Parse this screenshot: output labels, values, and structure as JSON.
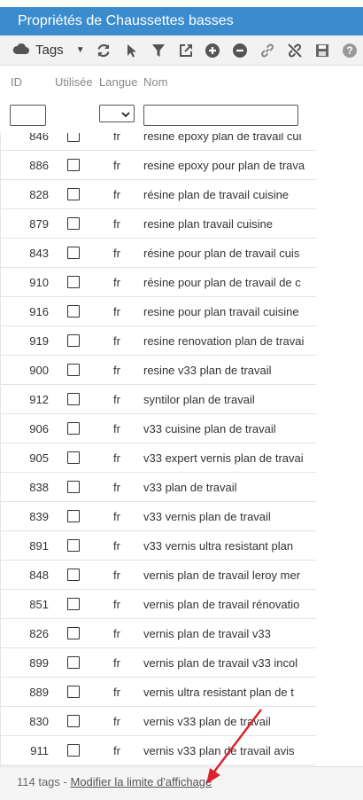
{
  "window": {
    "title": "Propriétés de Chaussettes basses"
  },
  "toolbar": {
    "tags_label": "Tags",
    "icons": [
      "cloud-icon",
      "refresh-icon",
      "pointer-icon",
      "filter-icon",
      "export-icon",
      "add-icon",
      "remove-icon",
      "link-icon",
      "unlink-icon",
      "save-icon",
      "help-icon"
    ]
  },
  "columns": {
    "id": "ID",
    "used": "Utilisée",
    "lang": "Langue",
    "name": "Nom"
  },
  "filters": {
    "id": "",
    "lang": "",
    "name": ""
  },
  "rows": [
    {
      "id": "846",
      "used": false,
      "lang": "fr",
      "name": "resine epoxy plan de travail cui"
    },
    {
      "id": "886",
      "used": false,
      "lang": "fr",
      "name": "resine epoxy pour plan de trava"
    },
    {
      "id": "828",
      "used": false,
      "lang": "fr",
      "name": "résine plan de travail cuisine"
    },
    {
      "id": "879",
      "used": false,
      "lang": "fr",
      "name": "resine plan travail cuisine"
    },
    {
      "id": "843",
      "used": false,
      "lang": "fr",
      "name": "résine pour plan de travail cuis"
    },
    {
      "id": "910",
      "used": false,
      "lang": "fr",
      "name": "résine pour plan de travail de c"
    },
    {
      "id": "916",
      "used": false,
      "lang": "fr",
      "name": "resine pour plan travail cuisine"
    },
    {
      "id": "919",
      "used": false,
      "lang": "fr",
      "name": "resine renovation plan de travai"
    },
    {
      "id": "900",
      "used": false,
      "lang": "fr",
      "name": "resine v33 plan de travail"
    },
    {
      "id": "912",
      "used": false,
      "lang": "fr",
      "name": "syntilor plan de travail"
    },
    {
      "id": "906",
      "used": false,
      "lang": "fr",
      "name": "v33 cuisine plan de travail"
    },
    {
      "id": "905",
      "used": false,
      "lang": "fr",
      "name": "v33 expert vernis plan de travai"
    },
    {
      "id": "838",
      "used": false,
      "lang": "fr",
      "name": "v33 plan de travail"
    },
    {
      "id": "839",
      "used": false,
      "lang": "fr",
      "name": "v33 vernis plan de travail"
    },
    {
      "id": "891",
      "used": false,
      "lang": "fr",
      "name": "v33 vernis ultra resistant plan"
    },
    {
      "id": "848",
      "used": false,
      "lang": "fr",
      "name": "vernis plan de travail leroy mer"
    },
    {
      "id": "851",
      "used": false,
      "lang": "fr",
      "name": "vernis plan de travail rénovatio"
    },
    {
      "id": "826",
      "used": false,
      "lang": "fr",
      "name": "vernis plan de travail v33"
    },
    {
      "id": "899",
      "used": false,
      "lang": "fr",
      "name": "vernis plan de travail v33 incol"
    },
    {
      "id": "889",
      "used": false,
      "lang": "fr",
      "name": "vernis ultra resistant plan de t"
    },
    {
      "id": "830",
      "used": false,
      "lang": "fr",
      "name": "vernis v33 plan de travail"
    },
    {
      "id": "911",
      "used": false,
      "lang": "fr",
      "name": "vernis v33 plan de travail avis"
    }
  ],
  "footer": {
    "count_text": "114 tags",
    "separator": " - ",
    "link_text": "Modifier la limite d'affichage"
  },
  "colors": {
    "title_bar": "#3b8ccf",
    "annotation_arrow": "#d9242f"
  }
}
